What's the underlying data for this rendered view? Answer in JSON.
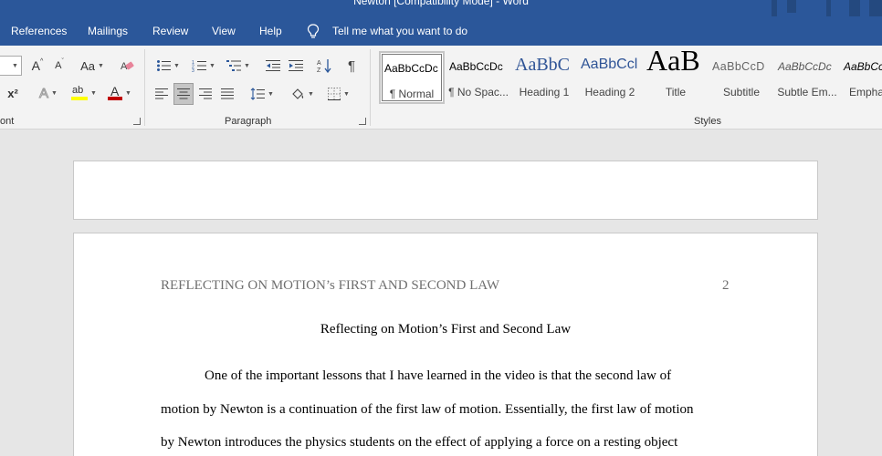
{
  "window": {
    "title": "Newton [Compatibility Mode]  -  Word"
  },
  "tabs": [
    {
      "label": "References"
    },
    {
      "label": "Mailings"
    },
    {
      "label": "Review"
    },
    {
      "label": "View"
    },
    {
      "label": "Help"
    }
  ],
  "tell_me": {
    "label": "Tell me what you want to do",
    "icon": "lightbulb-icon"
  },
  "ribbon": {
    "font_group": {
      "label": "ont",
      "grow_font": "A",
      "shrink_font": "A",
      "change_case": "Aa",
      "superscript": "x²",
      "text_effects": "A",
      "highlight": "ab",
      "font_color": "A",
      "highlight_color": "#ffff00",
      "font_color_value": "#c00000"
    },
    "paragraph_group": {
      "label": "Paragraph",
      "show_marks": "¶"
    },
    "styles_group": {
      "label": "Styles",
      "items": [
        {
          "preview": "AaBbCcDc",
          "name": "¶ Normal"
        },
        {
          "preview": "AaBbCcDc",
          "name": "¶ No Spac..."
        },
        {
          "preview": "AaBbC",
          "name": "Heading 1"
        },
        {
          "preview": "AaBbCcl",
          "name": "Heading 2"
        },
        {
          "preview": "AaB",
          "name": "Title"
        },
        {
          "preview": "AaBbCcD",
          "name": "Subtitle"
        },
        {
          "preview": "AaBbCcDc",
          "name": "Subtle Em..."
        },
        {
          "preview": "AaBbCcDc",
          "name": "Empha"
        }
      ]
    }
  },
  "document": {
    "header": "REFLECTING ON MOTION’s FIRST AND SECOND LAW",
    "page_number": "2",
    "title": "Reflecting on Motion’s First and Second Law",
    "lines": [
      "One of the important lessons that I have learned in the video is that the second law of",
      "motion by Newton is a continuation of the first law of motion. Essentially, the first law of motion",
      "by Newton introduces the physics students on the effect of applying a force on a resting object"
    ]
  },
  "colors": {
    "brand": "#2b579a",
    "ribbon_bg": "#f3f3f3",
    "canvas_bg": "#e6e6e6"
  }
}
